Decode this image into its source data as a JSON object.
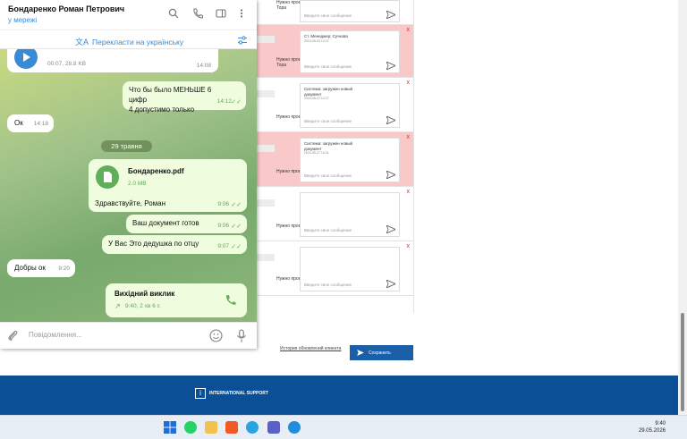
{
  "crm": {
    "rows": [
      {
        "labels": [
          "Нужно проверить",
          "Тора"
        ],
        "hint": "Введите свое сообщение",
        "message": null,
        "date": null,
        "red": false
      },
      {
        "labels": [
          "Нужно проверить",
          "Тора"
        ],
        "hint": "Введите свое сообщение",
        "message": "Ст. Менеджер: Сучкова",
        "date": "2024-05-03 12:47",
        "red": true
      },
      {
        "labels": [
          "Нужно проверить"
        ],
        "hint": "Введите свое сообщение",
        "message": "Система: загружен новый документ",
        "date": "2024-05-27 12:27",
        "red": false
      },
      {
        "labels": [
          "Нужно проверить"
        ],
        "hint": "Введите свое сообщение",
        "message": "Система: загружен новый документ",
        "date": "2024-05-27 16:31",
        "red": true
      },
      {
        "labels": [
          "Нужно проверить"
        ],
        "hint": "Введите свое сообщение",
        "message": null,
        "date": null,
        "red": false
      },
      {
        "labels": [
          "Нужно проверить"
        ],
        "hint": "Введите свое сообщение",
        "message": null,
        "date": null,
        "red": false
      }
    ],
    "close_symbol": "x",
    "history_link": "История обновлений клиента",
    "save_label": "Сохранить",
    "footer_logo": "INTERNATIONAL SUPPORT"
  },
  "telegram": {
    "contact_name": "Бондаренко Роман Петрович",
    "status": "у мережі",
    "translate_label": "Перекласти на українську",
    "voice": {
      "meta": "00:07, 28.8 KB",
      "time": "14:08"
    },
    "messages": [
      {
        "dir": "out",
        "text": "Что бы было МЕНЬШЕ 6 цифр\n4 допустимо только",
        "time": "14:12"
      },
      {
        "dir": "in",
        "text": "Ок",
        "time": "14:18"
      },
      {
        "dir": "date",
        "text": "29 травня"
      },
      {
        "dir": "out",
        "file_name": "Бондаренко.pdf",
        "file_size": "2.0 MB",
        "text": "Здравствуйте, Роман",
        "time": "9:06"
      },
      {
        "dir": "out",
        "text": "Ваш документ готов",
        "time": "9:06"
      },
      {
        "dir": "out",
        "text": "У Вас Это дедушка по отцу",
        "time": "9:07"
      },
      {
        "dir": "in",
        "text": "Добры ок",
        "time": "9:20"
      },
      {
        "dir": "out",
        "call_title": "Вихідний виклик",
        "call_meta": "9:40, 2 хв 6 с"
      }
    ],
    "input_placeholder": "Повідомлення..."
  },
  "taskbar": {
    "time": "9:40",
    "date": "29.05.2026",
    "apps": [
      "windows-start",
      "whatsapp",
      "file-explorer",
      "brave",
      "telegram",
      "teams",
      "edge"
    ]
  },
  "colors": {
    "accent": "#3a8bd6",
    "footer": "#0b4f97",
    "save_button": "#1a5fa8",
    "alert_row": "#f9c9c9",
    "outgoing_bubble": "#effdde"
  }
}
